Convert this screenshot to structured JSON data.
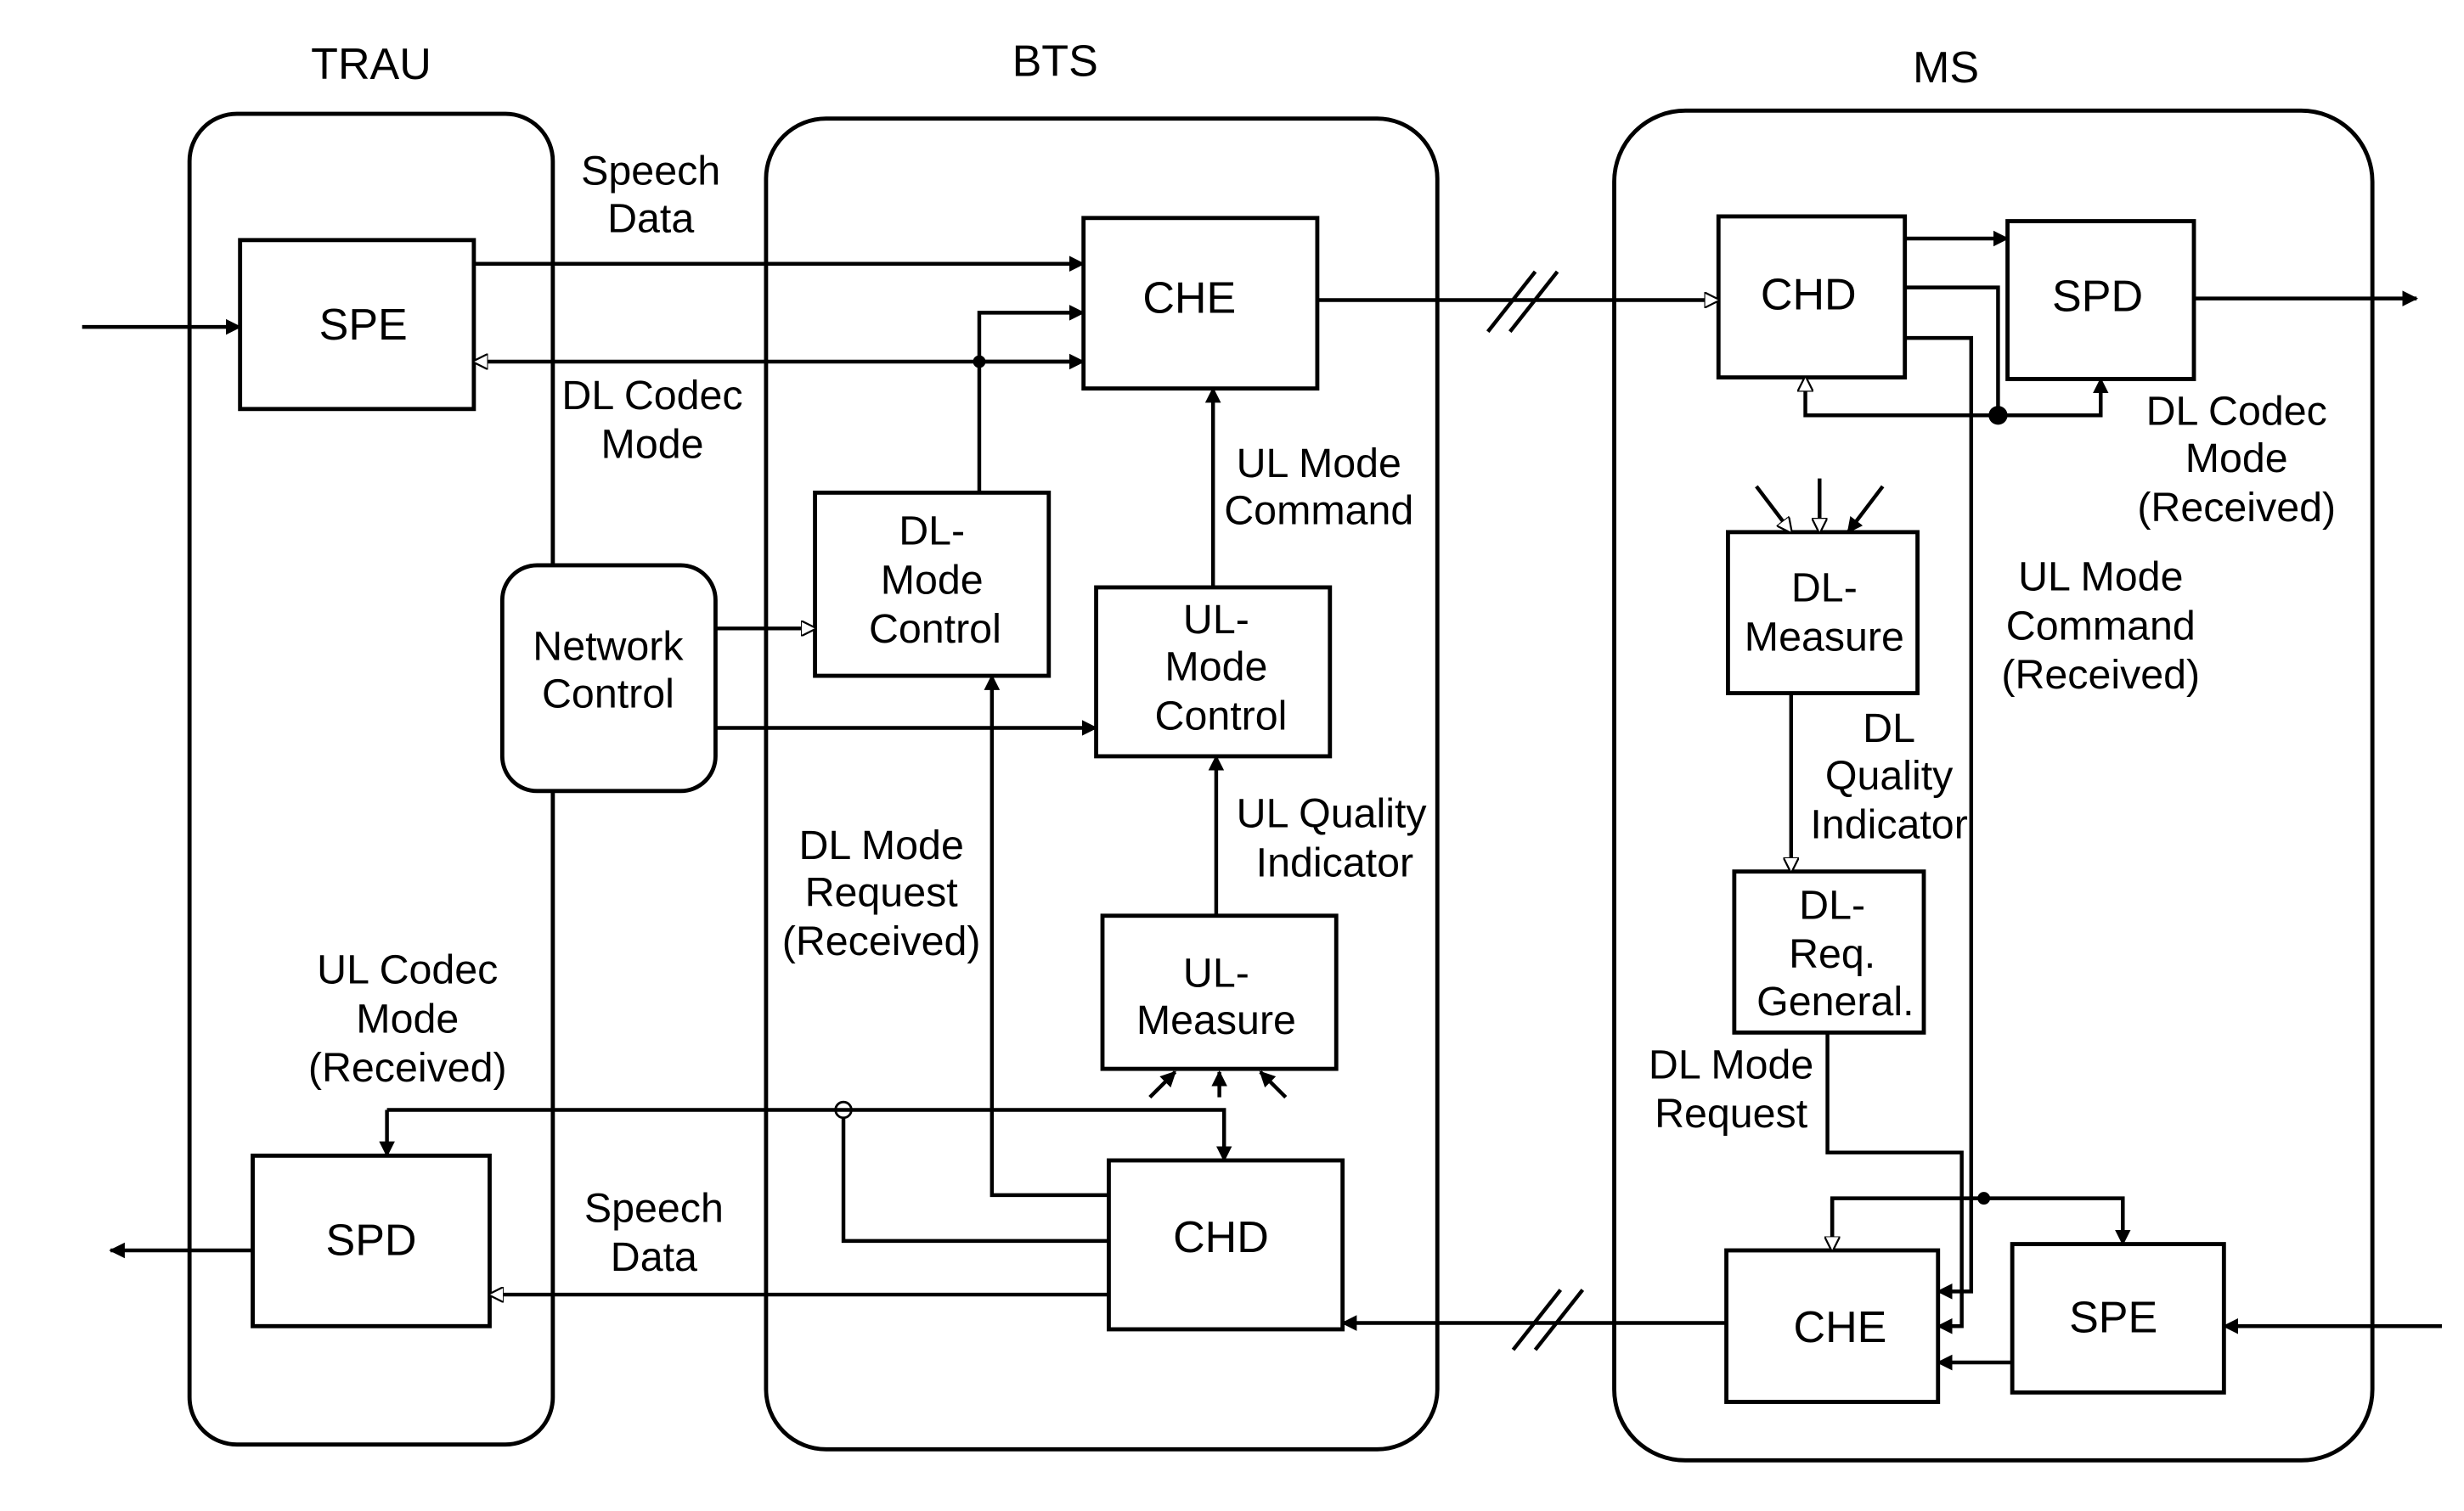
{
  "groups": {
    "trau": "TRAU",
    "bts": "BTS",
    "ms": "MS"
  },
  "blocks": {
    "trau_spe": "SPE",
    "trau_spd": "SPD",
    "network_control": [
      "Network",
      "Control"
    ],
    "bts_che": "CHE",
    "bts_chd": "CHD",
    "dl_mode_control": [
      "DL-",
      "Mode",
      "Control"
    ],
    "ul_mode_control": [
      "UL-",
      "Mode",
      "Control"
    ],
    "ul_measure": [
      "UL-",
      "Measure"
    ],
    "ms_chd": "CHD",
    "ms_spd": "SPD",
    "ms_che": "CHE",
    "ms_spe": "SPE",
    "dl_measure": [
      "DL-",
      "Measure"
    ],
    "dl_req_general": [
      "DL-",
      "Req.",
      "General."
    ]
  },
  "labels": {
    "speech_data_top": [
      "Speech",
      "Data"
    ],
    "dl_codec_mode": [
      "DL Codec",
      "Mode"
    ],
    "ul_mode_command": [
      "UL Mode",
      "Command"
    ],
    "ul_quality_indicator": [
      "UL Quality",
      "Indicator"
    ],
    "dl_mode_request_received": [
      "DL Mode",
      "Request",
      "(Received)"
    ],
    "ul_codec_mode_received": [
      "UL Codec",
      "Mode",
      "(Received)"
    ],
    "speech_data_bottom": [
      "Speech",
      "Data"
    ],
    "dl_codec_mode_received": [
      "DL Codec",
      "Mode",
      "(Received)"
    ],
    "ul_mode_command_received": [
      "UL Mode",
      "Command",
      "(Received)"
    ],
    "dl_quality_indicator": [
      "DL",
      "Quality",
      "Indicator"
    ],
    "dl_mode_request": [
      "DL Mode",
      "Request"
    ]
  }
}
